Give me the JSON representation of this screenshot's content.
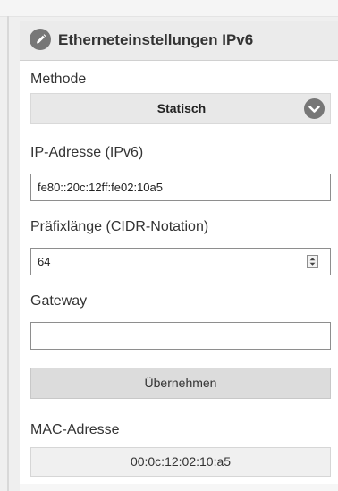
{
  "panel": {
    "title": "Etherneteinstellungen IPv6",
    "icon": "pencil-icon"
  },
  "method": {
    "label": "Methode",
    "selected": "Statisch",
    "icon": "chevron-down-icon"
  },
  "ip_address": {
    "label": "IP-Adresse (IPv6)",
    "value": "fe80::20c:12ff:fe02:10a5"
  },
  "prefix_length": {
    "label": "Präfixlänge (CIDR-Notation)",
    "value": "64",
    "icon": "spinner-icon"
  },
  "gateway": {
    "label": "Gateway",
    "value": ""
  },
  "apply_button": {
    "label": "Übernehmen"
  },
  "mac_address": {
    "label": "MAC-Adresse",
    "value": "00:0c:12:02:10:a5"
  },
  "colors": {
    "header_background": "#ebebeb",
    "icon_background": "#777777",
    "button_background": "#dcdcdc",
    "input_border": "#8e8e8e"
  }
}
